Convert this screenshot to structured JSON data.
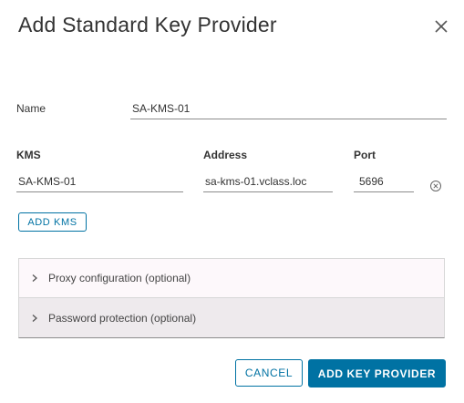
{
  "dialog": {
    "title": "Add Standard Key Provider"
  },
  "name_field": {
    "label": "Name",
    "value": "SA-KMS-01"
  },
  "kms_table": {
    "kms_label": "KMS",
    "address_label": "Address",
    "port_label": "Port",
    "kms_value": "SA-KMS-01",
    "address_value": "sa-kms-01.vclass.loc",
    "port_value": "5696"
  },
  "add_kms_button": "ADD KMS",
  "accordion": {
    "items": [
      {
        "label": "Proxy configuration (optional)"
      },
      {
        "label": "Password protection (optional)"
      }
    ]
  },
  "footer": {
    "cancel_label": "CANCEL",
    "submit_label": "ADD KEY PROVIDER"
  },
  "icons": {
    "close": "close-icon",
    "clear": "clear-circle-icon",
    "chevron": "chevron-right-icon"
  },
  "colors": {
    "accent": "#0072a3",
    "text": "#333333"
  }
}
